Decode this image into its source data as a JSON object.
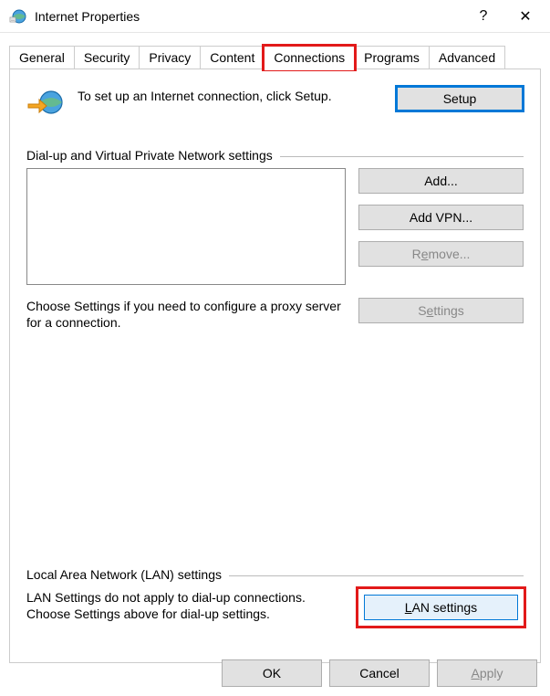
{
  "window": {
    "title": "Internet Properties",
    "help_glyph": "?",
    "close_glyph": "✕"
  },
  "tabs": {
    "items": [
      {
        "label": "General"
      },
      {
        "label": "Security"
      },
      {
        "label": "Privacy"
      },
      {
        "label": "Content"
      },
      {
        "label": "Connections",
        "active": true,
        "highlight": true
      },
      {
        "label": "Programs"
      },
      {
        "label": "Advanced"
      }
    ]
  },
  "setup": {
    "intro": "To set up an Internet connection, click Setup.",
    "button": "Setup"
  },
  "dialup": {
    "group_label": "Dial-up and Virtual Private Network settings",
    "add": "Add...",
    "add_vpn": "Add VPN...",
    "remove_prefix": "R",
    "remove_ul": "e",
    "remove_suffix": "move...",
    "help_text": "Choose Settings if you need to configure a proxy server for a connection.",
    "settings_prefix": "S",
    "settings_ul": "e",
    "settings_suffix": "ttings"
  },
  "lan": {
    "group_label": "Local Area Network (LAN) settings",
    "text": "LAN Settings do not apply to dial-up connections. Choose Settings above for dial-up settings.",
    "button_ul": "L",
    "button_suffix": "AN settings"
  },
  "dialog_buttons": {
    "ok": "OK",
    "cancel": "Cancel",
    "apply_ul": "A",
    "apply_suffix": "pply"
  }
}
